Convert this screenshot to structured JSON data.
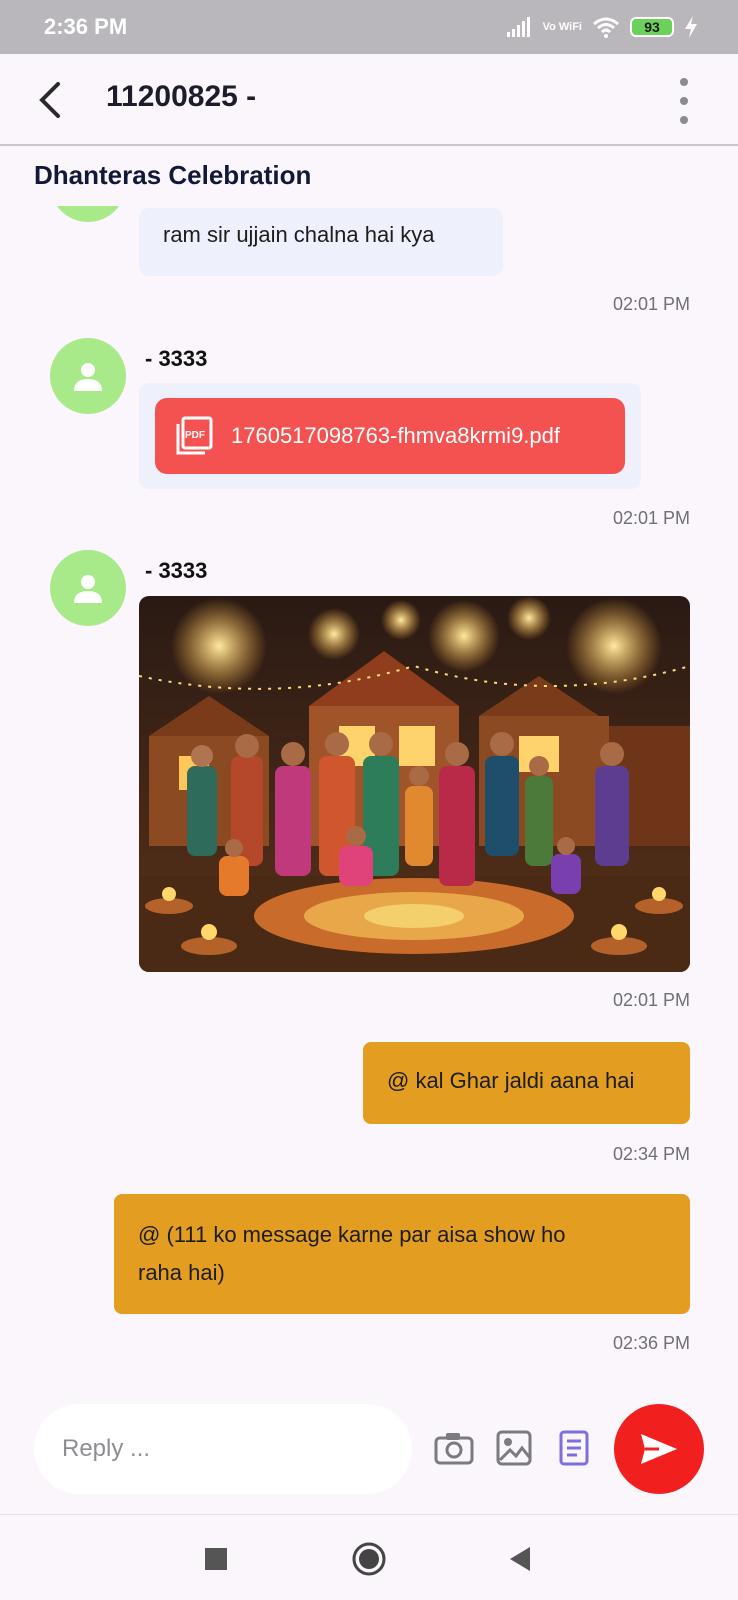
{
  "status_bar": {
    "time": "2:36 PM",
    "network": "Vo WiFi",
    "battery": "93"
  },
  "header": {
    "title": "11200825 -"
  },
  "group": {
    "name": "Dhanteras Celebration"
  },
  "messages": [
    {
      "text": "ram sir ujjain chalna hai kya",
      "time": "02:01 PM"
    },
    {
      "sender": "- 3333",
      "file_name": "1760517098763-fhmva8krmi9.pdf",
      "file_type": "PDF",
      "time": "02:01 PM"
    },
    {
      "sender": "- 3333",
      "image_desc": "diwali-family-image",
      "time": "02:01 PM"
    },
    {
      "text": "@ kal Ghar jaldi aana hai",
      "time": "02:34 PM"
    },
    {
      "text_line1": "@ (111 ko message karne par aisa show ho",
      "text_line2": "raha hai)",
      "time": "02:36 PM"
    }
  ],
  "composer": {
    "placeholder": "Reply ..."
  },
  "colors": {
    "accent": "#e39e21",
    "send": "#f21f1f",
    "avatar": "#a8e98a",
    "pdf": "#f45250"
  }
}
